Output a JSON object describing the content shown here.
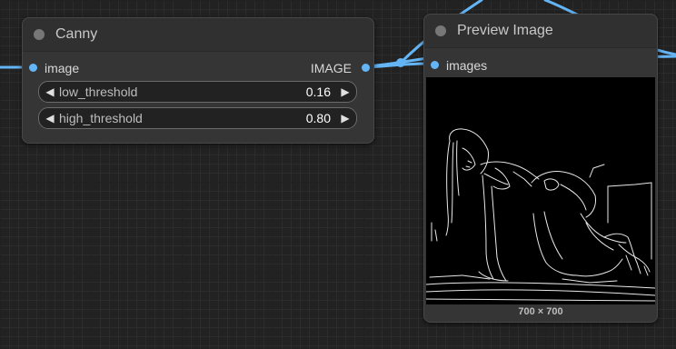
{
  "canny_node": {
    "title": "Canny",
    "input_label": "image",
    "output_label": "IMAGE",
    "widgets": [
      {
        "name": "low_threshold",
        "value": "0.16",
        "dec": "◀",
        "inc": "▶"
      },
      {
        "name": "high_threshold",
        "value": "0.80",
        "dec": "◀",
        "inc": "▶"
      }
    ]
  },
  "preview_node": {
    "title": "Preview Image",
    "input_label": "images",
    "image_description": "edge map",
    "dimensions": "700 × 700"
  },
  "colors": {
    "link": "#64b5f6",
    "node_bg": "#353535",
    "canvas_bg": "#222222"
  }
}
